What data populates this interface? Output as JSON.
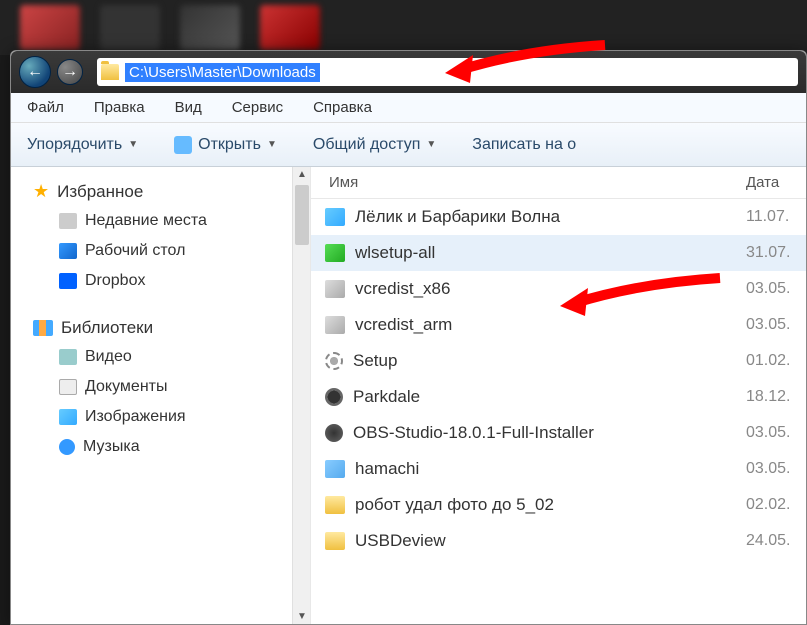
{
  "address_bar": {
    "path": "C:\\Users\\Master\\Downloads"
  },
  "menu": {
    "file": "Файл",
    "edit": "Правка",
    "view": "Вид",
    "service": "Сервис",
    "help": "Справка"
  },
  "toolbar": {
    "organize": "Упорядочить",
    "open": "Открыть",
    "share": "Общий доступ",
    "burn": "Записать на о"
  },
  "sidebar": {
    "favorites": {
      "label": "Избранное",
      "items": [
        {
          "label": "Недавние места",
          "icon": "recent"
        },
        {
          "label": "Рабочий стол",
          "icon": "desktop"
        },
        {
          "label": "Dropbox",
          "icon": "dropbox"
        }
      ]
    },
    "libraries": {
      "label": "Библиотеки",
      "items": [
        {
          "label": "Видео",
          "icon": "video"
        },
        {
          "label": "Документы",
          "icon": "doc"
        },
        {
          "label": "Изображения",
          "icon": "img"
        },
        {
          "label": "Музыка",
          "icon": "music"
        }
      ]
    }
  },
  "columns": {
    "name": "Имя",
    "date": "Дата"
  },
  "files": [
    {
      "name": "Лёлик и Барбарики Волна",
      "date": "11.07.",
      "icon": "img",
      "selected": false
    },
    {
      "name": "wlsetup-all",
      "date": "31.07.",
      "icon": "setup",
      "selected": true
    },
    {
      "name": "vcredist_x86",
      "date": "03.05.",
      "icon": "exe",
      "selected": false
    },
    {
      "name": "vcredist_arm",
      "date": "03.05.",
      "icon": "exe",
      "selected": false
    },
    {
      "name": "Setup",
      "date": "01.02.",
      "icon": "gear",
      "selected": false
    },
    {
      "name": "Parkdale",
      "date": "18.12.",
      "icon": "disk",
      "selected": false
    },
    {
      "name": "OBS-Studio-18.0.1-Full-Installer",
      "date": "03.05.",
      "icon": "obs",
      "selected": false
    },
    {
      "name": "hamachi",
      "date": "03.05.",
      "icon": "hamachi",
      "selected": false
    },
    {
      "name": "робот удал фото до 5_02",
      "date": "02.02.",
      "icon": "folder",
      "selected": false
    },
    {
      "name": "USBDeview",
      "date": "24.05.",
      "icon": "folder",
      "selected": false
    }
  ]
}
